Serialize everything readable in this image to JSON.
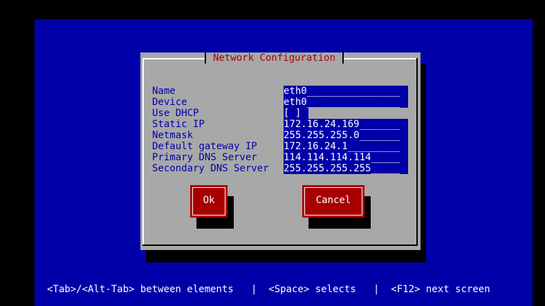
{
  "window": {
    "title": "Network Configuration"
  },
  "form": {
    "fields": [
      {
        "label": "Name",
        "value": "eth0________________"
      },
      {
        "label": "Device",
        "value": "eth0________________"
      },
      {
        "label": "Use DHCP",
        "value": "[ ]"
      },
      {
        "label": "Static IP",
        "value": "172.16.24.169_______"
      },
      {
        "label": "Netmask",
        "value": "255.255.255.0_______"
      },
      {
        "label": "Default gateway IP",
        "value": "172.16.24.1_________"
      },
      {
        "label": "Primary DNS Server",
        "value": "114.114.114.114_____"
      },
      {
        "label": "Secondary DNS Server",
        "value": "255.255.255.255_____"
      }
    ]
  },
  "buttons": {
    "ok_label": "Ok",
    "cancel_label": "Cancel"
  },
  "status_bar": {
    "text": "<Tab>/<Alt-Tab> between elements   |  <Space> selects   |  <F12> next screen"
  },
  "colors": {
    "background": "#0000a8",
    "dialog": "#a8a8a8",
    "title": "#a80000",
    "button": "#a80000",
    "field": "#0000a8"
  }
}
